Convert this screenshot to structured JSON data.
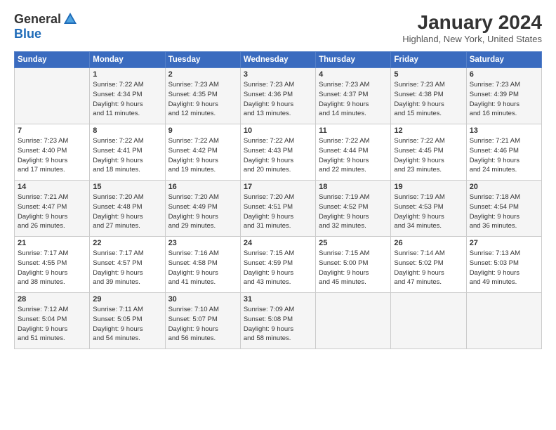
{
  "header": {
    "logo_general": "General",
    "logo_blue": "Blue",
    "title": "January 2024",
    "location": "Highland, New York, United States"
  },
  "days_of_week": [
    "Sunday",
    "Monday",
    "Tuesday",
    "Wednesday",
    "Thursday",
    "Friday",
    "Saturday"
  ],
  "weeks": [
    [
      {
        "day": "",
        "content": ""
      },
      {
        "day": "1",
        "content": "Sunrise: 7:22 AM\nSunset: 4:34 PM\nDaylight: 9 hours\nand 11 minutes."
      },
      {
        "day": "2",
        "content": "Sunrise: 7:23 AM\nSunset: 4:35 PM\nDaylight: 9 hours\nand 12 minutes."
      },
      {
        "day": "3",
        "content": "Sunrise: 7:23 AM\nSunset: 4:36 PM\nDaylight: 9 hours\nand 13 minutes."
      },
      {
        "day": "4",
        "content": "Sunrise: 7:23 AM\nSunset: 4:37 PM\nDaylight: 9 hours\nand 14 minutes."
      },
      {
        "day": "5",
        "content": "Sunrise: 7:23 AM\nSunset: 4:38 PM\nDaylight: 9 hours\nand 15 minutes."
      },
      {
        "day": "6",
        "content": "Sunrise: 7:23 AM\nSunset: 4:39 PM\nDaylight: 9 hours\nand 16 minutes."
      }
    ],
    [
      {
        "day": "7",
        "content": "Sunrise: 7:23 AM\nSunset: 4:40 PM\nDaylight: 9 hours\nand 17 minutes."
      },
      {
        "day": "8",
        "content": "Sunrise: 7:22 AM\nSunset: 4:41 PM\nDaylight: 9 hours\nand 18 minutes."
      },
      {
        "day": "9",
        "content": "Sunrise: 7:22 AM\nSunset: 4:42 PM\nDaylight: 9 hours\nand 19 minutes."
      },
      {
        "day": "10",
        "content": "Sunrise: 7:22 AM\nSunset: 4:43 PM\nDaylight: 9 hours\nand 20 minutes."
      },
      {
        "day": "11",
        "content": "Sunrise: 7:22 AM\nSunset: 4:44 PM\nDaylight: 9 hours\nand 22 minutes."
      },
      {
        "day": "12",
        "content": "Sunrise: 7:22 AM\nSunset: 4:45 PM\nDaylight: 9 hours\nand 23 minutes."
      },
      {
        "day": "13",
        "content": "Sunrise: 7:21 AM\nSunset: 4:46 PM\nDaylight: 9 hours\nand 24 minutes."
      }
    ],
    [
      {
        "day": "14",
        "content": "Sunrise: 7:21 AM\nSunset: 4:47 PM\nDaylight: 9 hours\nand 26 minutes."
      },
      {
        "day": "15",
        "content": "Sunrise: 7:20 AM\nSunset: 4:48 PM\nDaylight: 9 hours\nand 27 minutes."
      },
      {
        "day": "16",
        "content": "Sunrise: 7:20 AM\nSunset: 4:49 PM\nDaylight: 9 hours\nand 29 minutes."
      },
      {
        "day": "17",
        "content": "Sunrise: 7:20 AM\nSunset: 4:51 PM\nDaylight: 9 hours\nand 31 minutes."
      },
      {
        "day": "18",
        "content": "Sunrise: 7:19 AM\nSunset: 4:52 PM\nDaylight: 9 hours\nand 32 minutes."
      },
      {
        "day": "19",
        "content": "Sunrise: 7:19 AM\nSunset: 4:53 PM\nDaylight: 9 hours\nand 34 minutes."
      },
      {
        "day": "20",
        "content": "Sunrise: 7:18 AM\nSunset: 4:54 PM\nDaylight: 9 hours\nand 36 minutes."
      }
    ],
    [
      {
        "day": "21",
        "content": "Sunrise: 7:17 AM\nSunset: 4:55 PM\nDaylight: 9 hours\nand 38 minutes."
      },
      {
        "day": "22",
        "content": "Sunrise: 7:17 AM\nSunset: 4:57 PM\nDaylight: 9 hours\nand 39 minutes."
      },
      {
        "day": "23",
        "content": "Sunrise: 7:16 AM\nSunset: 4:58 PM\nDaylight: 9 hours\nand 41 minutes."
      },
      {
        "day": "24",
        "content": "Sunrise: 7:15 AM\nSunset: 4:59 PM\nDaylight: 9 hours\nand 43 minutes."
      },
      {
        "day": "25",
        "content": "Sunrise: 7:15 AM\nSunset: 5:00 PM\nDaylight: 9 hours\nand 45 minutes."
      },
      {
        "day": "26",
        "content": "Sunrise: 7:14 AM\nSunset: 5:02 PM\nDaylight: 9 hours\nand 47 minutes."
      },
      {
        "day": "27",
        "content": "Sunrise: 7:13 AM\nSunset: 5:03 PM\nDaylight: 9 hours\nand 49 minutes."
      }
    ],
    [
      {
        "day": "28",
        "content": "Sunrise: 7:12 AM\nSunset: 5:04 PM\nDaylight: 9 hours\nand 51 minutes."
      },
      {
        "day": "29",
        "content": "Sunrise: 7:11 AM\nSunset: 5:05 PM\nDaylight: 9 hours\nand 54 minutes."
      },
      {
        "day": "30",
        "content": "Sunrise: 7:10 AM\nSunset: 5:07 PM\nDaylight: 9 hours\nand 56 minutes."
      },
      {
        "day": "31",
        "content": "Sunrise: 7:09 AM\nSunset: 5:08 PM\nDaylight: 9 hours\nand 58 minutes."
      },
      {
        "day": "",
        "content": ""
      },
      {
        "day": "",
        "content": ""
      },
      {
        "day": "",
        "content": ""
      }
    ]
  ]
}
